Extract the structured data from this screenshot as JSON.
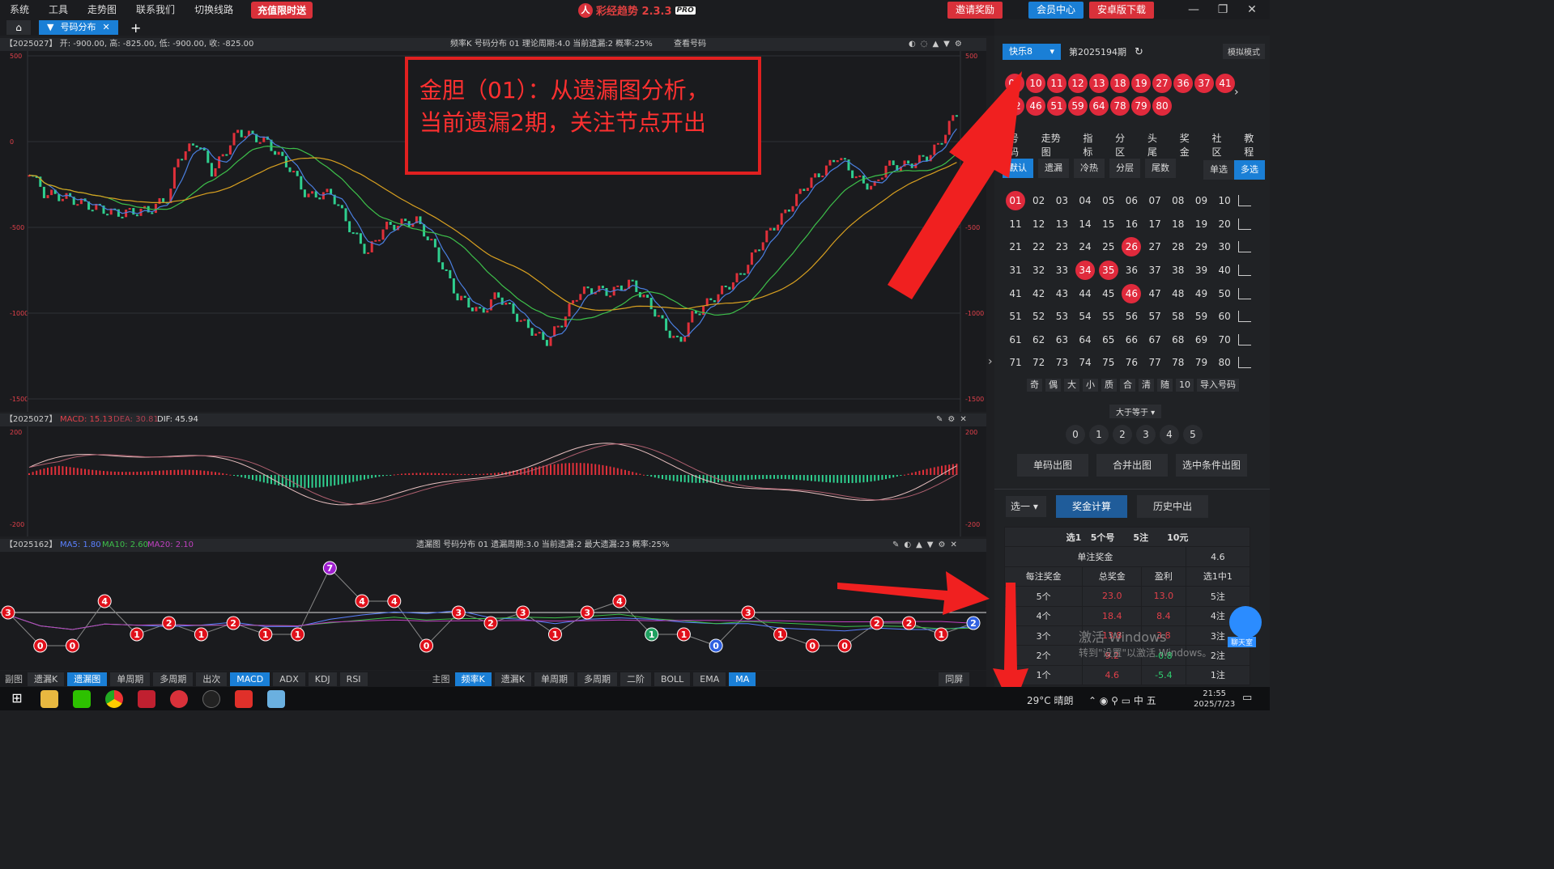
{
  "menu": [
    "系统",
    "工具",
    "走势图",
    "联系我们",
    "切换线路"
  ],
  "promo": "充值限时送",
  "app": {
    "title": "彩经趋势 2.3.3",
    "pro": "PRO"
  },
  "topbuttons": {
    "invite": "邀请奖励",
    "member": "会员中心",
    "android": "安卓版下载"
  },
  "tab": {
    "label": "号码分布",
    "close": "✕",
    "add": "+"
  },
  "kline_head": {
    "left": "【2025027】 开: -900.00, 高: -825.00, 低: -900.00, 收: -825.00",
    "center": "频率K  号码分布  01    理论周期:4.0  当前遗漏:2  概率:25%",
    "view": "查看号码"
  },
  "kline_axis": {
    "left": [
      "500",
      "0",
      "-500",
      "-1000",
      "-1500"
    ],
    "right": [
      "500",
      "-500",
      "-1000",
      "-1500"
    ]
  },
  "annotation": [
    "金胆（01）：从遗漏图分析，",
    "当前遗漏2期，关注节点开出"
  ],
  "macd_head": {
    "issue": "【2025027】",
    "macd": "MACD: 15.13",
    "dea": "DEA: 30.81",
    "dif": "DIF: 45.94"
  },
  "macd_axis": {
    "top": "200",
    "bottom": "-200"
  },
  "miss_head": {
    "issue": "【2025162】",
    "ma5": "MA5: 1.80",
    "ma10": "MA10: 2.60",
    "ma20": "MA20: 2.10",
    "center": "遗漏图  号码分布  01    遗漏周期:3.0  当前遗漏:2  最大遗漏:23  概率:25%"
  },
  "miss_values": [
    3,
    0,
    0,
    4,
    1,
    2,
    1,
    2,
    1,
    1,
    7,
    4,
    4,
    0,
    3,
    2,
    3,
    1,
    3,
    4,
    1,
    1,
    0,
    3,
    1,
    0,
    0,
    2,
    2,
    1,
    2
  ],
  "indicators": {
    "sub_label": "副图",
    "sub": [
      {
        "label": "遗漏K",
        "on": false
      },
      {
        "label": "遗漏图",
        "on": true
      },
      {
        "label": "单周期",
        "on": false
      },
      {
        "label": "多周期",
        "on": false
      },
      {
        "label": "出次",
        "on": false
      },
      {
        "label": "MACD",
        "on": true
      },
      {
        "label": "ADX",
        "on": false
      },
      {
        "label": "KDJ",
        "on": false
      },
      {
        "label": "RSI",
        "on": false
      }
    ],
    "main_label": "主图",
    "main": [
      {
        "label": "频率K",
        "on": true
      },
      {
        "label": "遗漏K",
        "on": false
      },
      {
        "label": "单周期",
        "on": false
      },
      {
        "label": "多周期",
        "on": false
      },
      {
        "label": "二阶",
        "on": false
      },
      {
        "label": "BOLL",
        "on": false
      },
      {
        "label": "EMA",
        "on": false
      },
      {
        "label": "MA",
        "on": true
      }
    ],
    "sync": "同屏"
  },
  "right": {
    "lottery": "快乐8",
    "issue": "第2025194期",
    "sim": "模拟模式",
    "drawn": [
      "02",
      "10",
      "11",
      "12",
      "13",
      "18",
      "19",
      "27",
      "36",
      "37",
      "41",
      "42",
      "46",
      "51",
      "59",
      "64",
      "78",
      "79",
      "80"
    ],
    "nav": [
      "号码",
      "走势图",
      "指标",
      "分区",
      "头尾",
      "奖金",
      "社区",
      "教程"
    ],
    "filters": [
      {
        "label": "默认",
        "on": true
      },
      {
        "label": "遗漏",
        "on": false
      },
      {
        "label": "冷热",
        "on": false
      },
      {
        "label": "分层",
        "on": false
      },
      {
        "label": "尾数",
        "on": false
      }
    ],
    "mode": [
      {
        "label": "单选",
        "on": false
      },
      {
        "label": "多选",
        "on": true
      }
    ],
    "selected": [
      "01",
      "26",
      "34",
      "35",
      "46"
    ],
    "quick": [
      "奇",
      "偶",
      "大",
      "小",
      "质",
      "合",
      "清",
      "随",
      "10",
      "导入号码"
    ],
    "ge": "大于等于",
    "counts": [
      "0",
      "1",
      "2",
      "3",
      "4",
      "5"
    ],
    "chartbtns": [
      "单码出图",
      "合并出图",
      "选中条件出图"
    ],
    "pick": "选一",
    "calc": "奖金计算",
    "hist": "历史中出",
    "summary": {
      "pick": "选1",
      "nums": "5个号",
      "bets": "5注",
      "cost": "10元"
    },
    "single_prize_label": "单注奖金",
    "single_prize": "4.6",
    "cols": [
      "每注奖金",
      "总奖金",
      "盈利",
      "选1中1"
    ],
    "rows": [
      {
        "hit": "5个",
        "total": "23.0",
        "profit": "13.0",
        "bets": "5注",
        "pos": true
      },
      {
        "hit": "4个",
        "total": "18.4",
        "profit": "8.4",
        "bets": "4注",
        "pos": true
      },
      {
        "hit": "3个",
        "total": "13.8",
        "profit": "3.8",
        "bets": "3注",
        "pos": true
      },
      {
        "hit": "2个",
        "total": "9.2",
        "profit": "-0.8",
        "bets": "2注",
        "pos": false
      },
      {
        "hit": "1个",
        "total": "4.6",
        "profit": "-5.4",
        "bets": "1注",
        "pos": false
      }
    ],
    "watermark": "激活 Windows",
    "watermark_sub": "转到\"设置\"以激活 Windows。",
    "chat": "聊天室"
  },
  "taskbar": {
    "weather": "29°C  晴朗",
    "ime": "中",
    "time": "21:55",
    "date": "2025/7/23"
  },
  "colors": {
    "accent": "#1a7fd6",
    "red": "#e02a3c",
    "green_candle": "#2fcf8f",
    "ma_blue": "#4a7fe0",
    "ma_green": "#3dbf4a",
    "ma_orange": "#d8a020"
  }
}
